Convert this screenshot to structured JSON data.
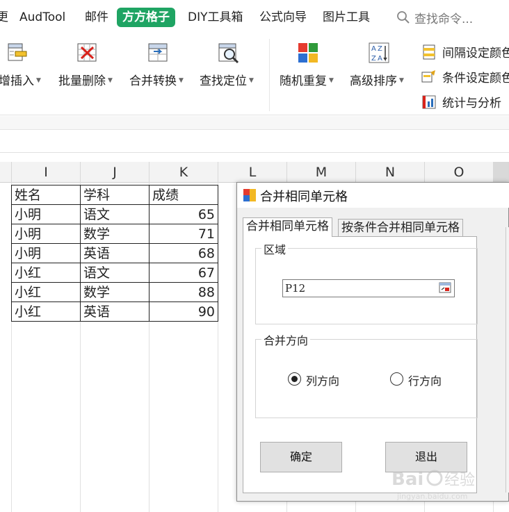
{
  "menu": {
    "items": [
      {
        "label": "更"
      },
      {
        "label": "AudTool"
      },
      {
        "label": "邮件"
      },
      {
        "label": "方方格子",
        "active": true
      },
      {
        "label": "DIY工具箱"
      },
      {
        "label": "公式向导"
      },
      {
        "label": "图片工具"
      }
    ],
    "search_placeholder": "查找命令..."
  },
  "ribbon": {
    "buttons": [
      {
        "label": "增插入",
        "icon": "insert-icon"
      },
      {
        "label": "批量删除",
        "icon": "batch-delete-icon"
      },
      {
        "label": "合并转换",
        "icon": "merge-convert-icon"
      },
      {
        "label": "查找定位",
        "icon": "find-locate-icon"
      },
      {
        "label": "随机重复",
        "icon": "random-repeat-icon"
      },
      {
        "label": "高级排序",
        "icon": "advanced-sort-icon"
      }
    ],
    "small_buttons": [
      {
        "label": "间隔设定颜色",
        "icon": "interval-color-icon"
      },
      {
        "label": "条件设定颜色",
        "icon": "condition-color-icon"
      },
      {
        "label": "统计与分析",
        "icon": "statistics-icon"
      }
    ]
  },
  "grid": {
    "columns": [
      "I",
      "J",
      "K",
      "L",
      "M",
      "N",
      "O"
    ],
    "rows": [
      [
        "姓名",
        "学科",
        "成绩"
      ],
      [
        "小明",
        "语文",
        "65"
      ],
      [
        "小明",
        "数学",
        "71"
      ],
      [
        "小明",
        "英语",
        "68"
      ],
      [
        "小红",
        "语文",
        "67"
      ],
      [
        "小红",
        "数学",
        "88"
      ],
      [
        "小红",
        "英语",
        "90"
      ]
    ]
  },
  "dialog": {
    "title": "合并相同单元格",
    "tabs": [
      "合并相同单元格",
      "按条件合并相同单元格"
    ],
    "region_label": "区域",
    "region_value": "P12",
    "direction_label": "合并方向",
    "radio_column": "列方向",
    "radio_row": "行方向",
    "selected_direction": "column",
    "ok_label": "确定",
    "exit_label": "退出"
  },
  "colors": {
    "active_tab": "#1fa463",
    "grid_border": "#222222",
    "dialog_bg": "#f0f0f0"
  }
}
